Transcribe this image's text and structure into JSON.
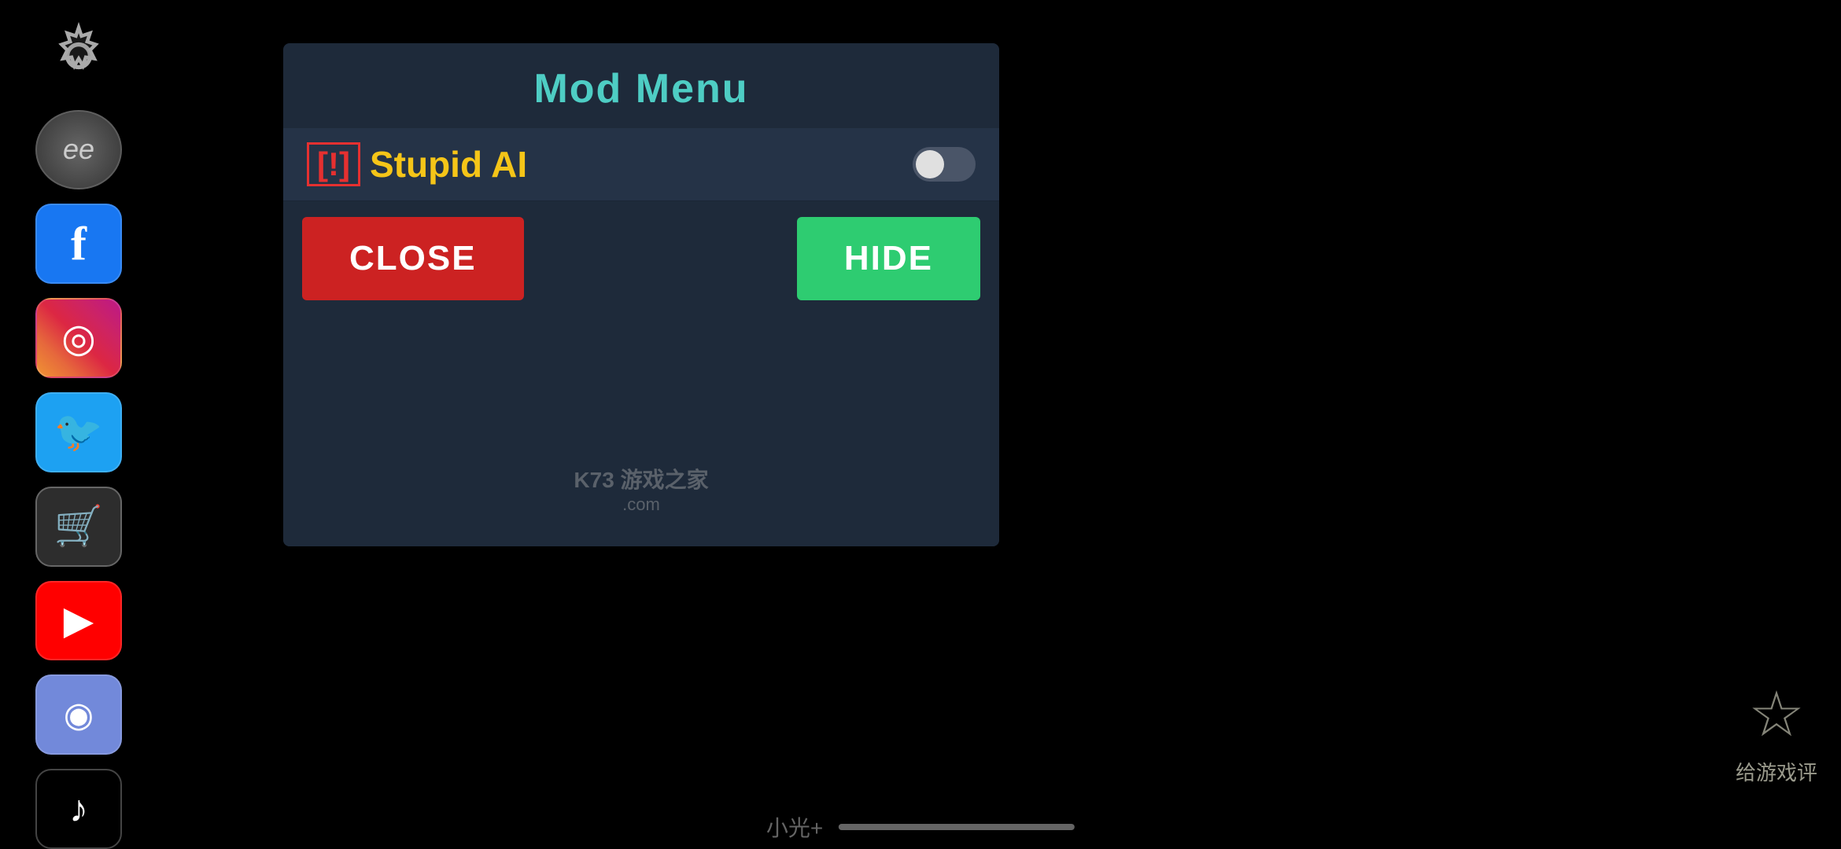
{
  "header": {
    "title": "Mod Menu"
  },
  "mod_item": {
    "exclamation": "[!]",
    "name": "Stupid AI",
    "toggle_state": "off"
  },
  "buttons": {
    "close_label": "CLOSE",
    "hide_label": "HIDE"
  },
  "watermark": {
    "line1": "K73 游戏之家",
    "line2": ".com"
  },
  "sidebar": {
    "icons": [
      {
        "name": "settings",
        "symbol": "⚙"
      },
      {
        "name": "avatar",
        "symbol": "ee"
      },
      {
        "name": "facebook",
        "symbol": "f"
      },
      {
        "name": "instagram",
        "symbol": "◎"
      },
      {
        "name": "twitter",
        "symbol": "🐦"
      },
      {
        "name": "shop",
        "symbol": "🛒"
      },
      {
        "name": "youtube",
        "symbol": "▶"
      },
      {
        "name": "discord",
        "symbol": "◉"
      },
      {
        "name": "tiktok",
        "symbol": "♪"
      }
    ]
  },
  "bottom_hint": {
    "text": "小光+",
    "bar_label": ""
  },
  "star_rating": {
    "label": "给游戏评"
  },
  "colors": {
    "accent_teal": "#4ecdc4",
    "warning_red": "#e63030",
    "mod_name_yellow": "#f5c518",
    "panel_bg": "#1e2a3a",
    "row_bg": "#253347",
    "close_btn": "#cc2222",
    "hide_btn": "#2ecc71"
  }
}
